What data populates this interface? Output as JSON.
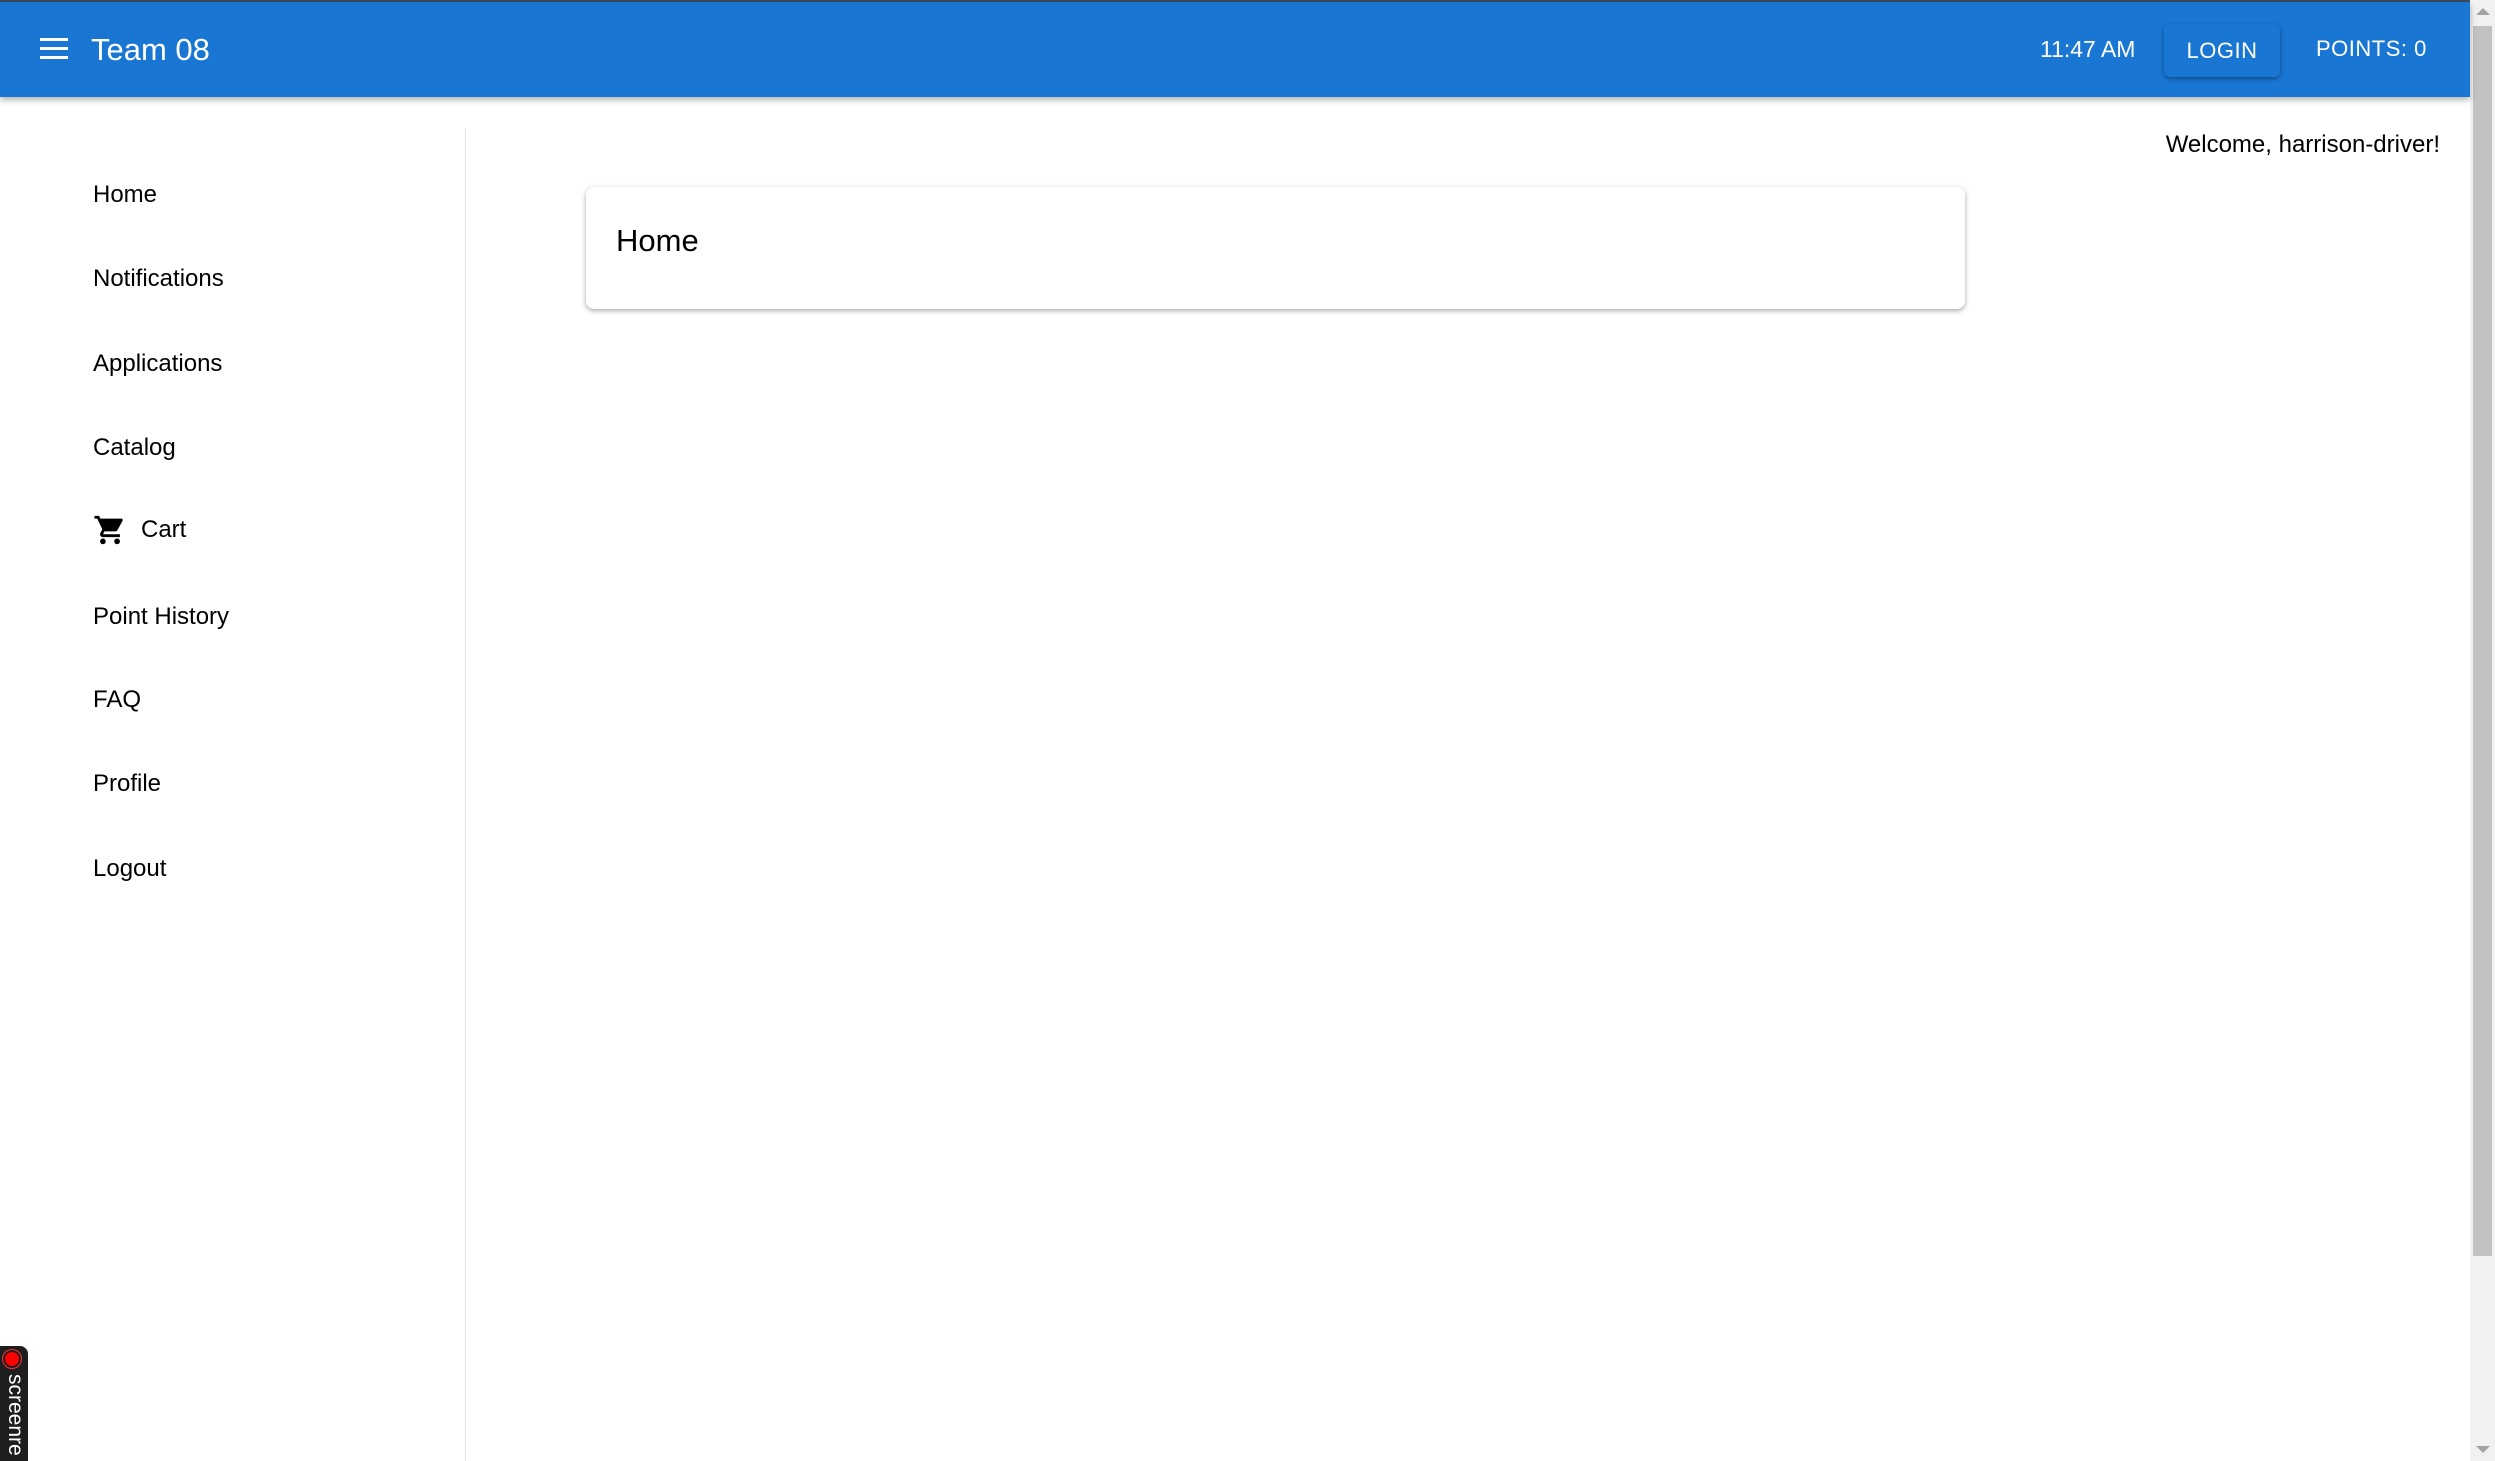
{
  "appbar": {
    "title": "Team 08",
    "time": "11:47 AM",
    "login_label": "LOGIN",
    "points_label": "POINTS: 0",
    "color": "#1976d2"
  },
  "sidebar": {
    "items": [
      {
        "label": "Home"
      },
      {
        "label": "Notifications"
      },
      {
        "label": "Applications"
      },
      {
        "label": "Catalog"
      },
      {
        "label": "Cart",
        "icon": "cart-icon"
      },
      {
        "label": "Point History"
      },
      {
        "label": "FAQ"
      },
      {
        "label": "Profile"
      },
      {
        "label": "Logout"
      }
    ]
  },
  "main": {
    "welcome": "Welcome, harrison-driver!",
    "card_title": "Home"
  },
  "recorder": {
    "label": "screenre"
  }
}
